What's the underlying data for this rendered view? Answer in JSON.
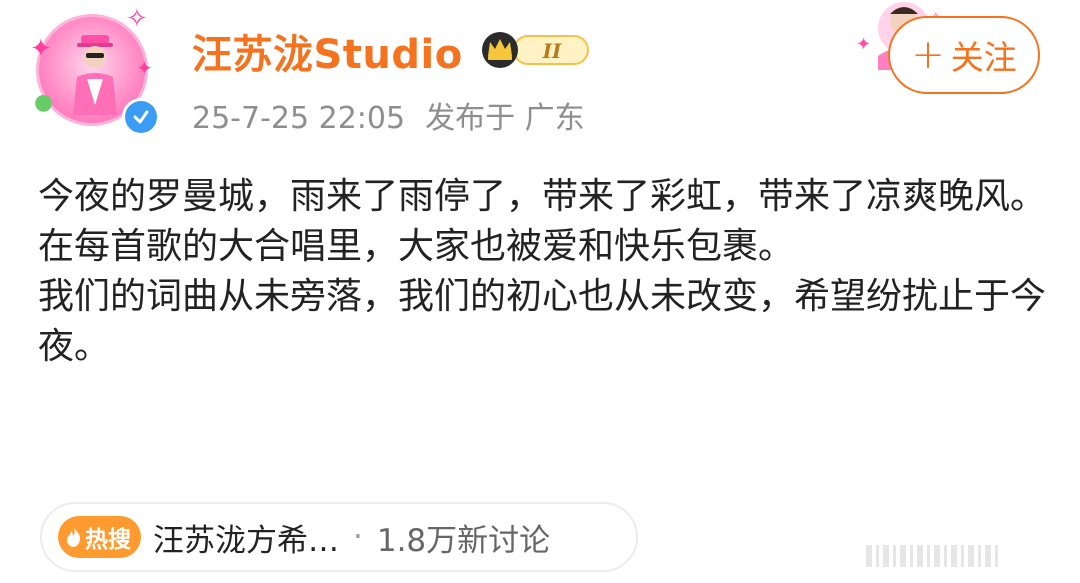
{
  "header": {
    "username": "汪苏泷Studio",
    "level_badge": "II",
    "timestamp": "25-7-25 22:05",
    "location": "发布于 广东",
    "follow_label": "关注",
    "follow_icon": "plus-icon",
    "verified_icon": "verified-check-icon"
  },
  "post": {
    "paragraphs": [
      "今夜的罗曼城，雨来了雨停了，带来了彩虹，带来了凉爽晚风。在每首歌的大合唱里，大家也被爱和快乐包裹。",
      "我们的词曲从未旁落，我们的初心也从未改变，希望纷扰止于今夜。"
    ]
  },
  "hot_search": {
    "tag": "热搜",
    "topic": "汪苏泷方希…",
    "separator": "·",
    "count": "1.8万新讨论"
  },
  "colors": {
    "accent": "#f5731f",
    "hot_tag": "#ff9b2e",
    "verified": "#3a9cf5",
    "text": "#222222",
    "meta": "#8e8e8e"
  }
}
